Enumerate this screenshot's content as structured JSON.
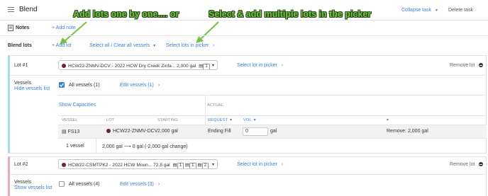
{
  "header": {
    "title": "Blend",
    "collapse_label": "Collapse task",
    "delete_label": "Delete task"
  },
  "annotations": {
    "left": "Add lots one by one.... or",
    "right": "Select & add multiple lots in the picker"
  },
  "notes": {
    "label": "Notes",
    "add_note": "+ Add note"
  },
  "blend_lots": {
    "label": "Blend lots",
    "add_lot": "+ Add lot",
    "select_all": "Select all / Clear all vessels",
    "picker": "Select lots in picker"
  },
  "lot1": {
    "label": "Lot #1",
    "select_text": "HCW22-ZNMV-DCV - 2022 HCW Dry Creek Zinfa...  2,000 gal",
    "badge": "1",
    "picker": "Select lot in picker",
    "remove": "Remove lot",
    "vessels_label": "Vessels",
    "vessels_toggle": "Hide vessels list",
    "all_vessels": "All vessels (1)",
    "edit_vessels": "Edit vessels (1)",
    "show_capacities": "Show Capacities",
    "actual_header": "ACTUAL",
    "table_headers": {
      "vessel": "VESSEL",
      "lot": "LOT",
      "starting": "STARTING",
      "request": "REQUEST",
      "vol": "VOL"
    },
    "row": {
      "vessel": "FS13",
      "lot": "HCW22-ZNMV-DCV",
      "starting": "2,000 gal",
      "request": "Ending Fill",
      "vol_value": "0",
      "vol_unit": "gal",
      "remove_text": "Remove: 2,000 gal"
    },
    "footer": {
      "count": "1 vessel",
      "change": "2,000 gal  ⟶  0 gal (-2,000 gal change)"
    }
  },
  "lot2": {
    "label": "Lot #2",
    "select_text": "HCW22-CSMTPK2 - 2022 HCW Moun...  72.5 gal",
    "badges": [
      "1",
      "1",
      "2"
    ],
    "picker": "Select lot in picker",
    "remove": "Remove lot",
    "vessels_label": "Vessels",
    "vessels_toggle": "Show vessels list",
    "all_vessels": "All vessels (4)",
    "edit_vessels": "Edit vessels (3)"
  },
  "colors": {
    "accent": "#3b7fd4",
    "lot1_border": "#a7dde8",
    "lot2_border": "#e9a8c4",
    "wine_dot": "#6b2230",
    "callout_green": "#76c04a"
  },
  "icons": [
    "hamburger-icon",
    "note-icon",
    "chevron-down-icon",
    "chevron-right-icon",
    "remove-icon",
    "tank-icon",
    "arrow-right-icon",
    "checkbox-icon"
  ]
}
